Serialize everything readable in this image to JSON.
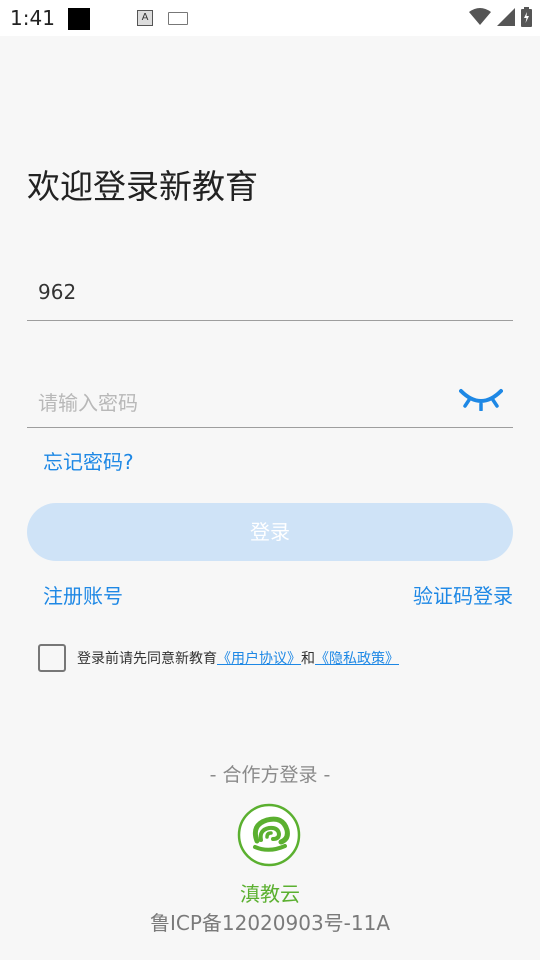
{
  "status_bar": {
    "time": "1:41",
    "ime_letter": "A"
  },
  "login": {
    "title": "欢迎登录新教育",
    "account_value": "962",
    "password_placeholder": "请输入密码",
    "forgot_password": "忘记密码?",
    "login_button": "登录",
    "register": "注册账号",
    "code_login": "验证码登录",
    "agreement_prefix": "登录前请先同意新教育",
    "user_agreement": "《用户协议》",
    "agreement_and": "和",
    "privacy_policy": "《隐私政策》"
  },
  "partner": {
    "section_label": "- 合作方登录 -",
    "dianjiao_name": "滇教云",
    "icp": "鲁ICP备12020903号-11A"
  },
  "colors": {
    "accent": "#1e88e5",
    "button_disabled": "#cfe3f7",
    "partner_green": "#5bb030"
  },
  "icons": [
    "eye-closed-icon",
    "wifi-icon",
    "signal-icon",
    "battery-icon",
    "dianjiao-logo-icon"
  ]
}
